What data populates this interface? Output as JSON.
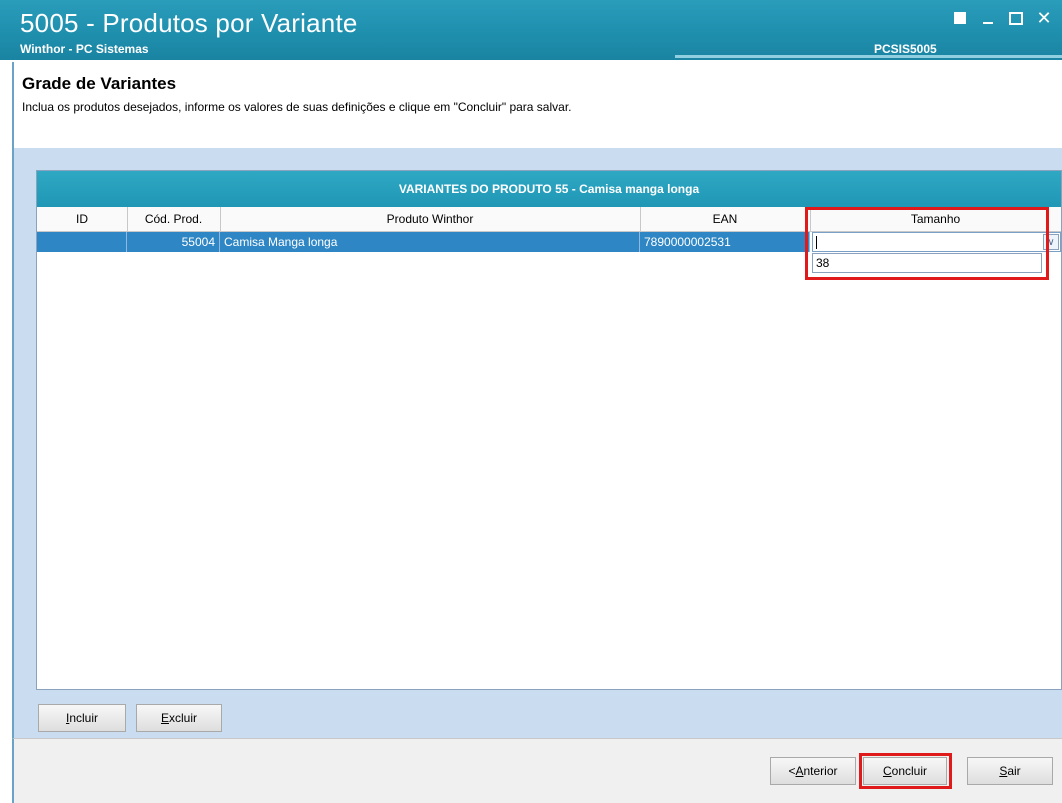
{
  "window": {
    "title": "5005 - Produtos por Variante",
    "subtitle": "Winthor - PC Sistemas",
    "module_code": "PCSIS5005",
    "controls": {
      "restore": "restore",
      "minimize": "minimize",
      "maximize": "maximize",
      "close": "✕"
    }
  },
  "header": {
    "title": "Grade de Variantes",
    "description": "Inclua os produtos desejados, informe os valores de suas definições e clique em \"Concluir\" para salvar."
  },
  "grid": {
    "caption": "VARIANTES DO PRODUTO 55 - Camisa manga longa",
    "columns": [
      "ID",
      "Cód. Prod.",
      "Produto Winthor",
      "EAN",
      "Tamanho"
    ],
    "rows": [
      {
        "id": "",
        "cod_prod": "55004",
        "produto": "Camisa Manga longa",
        "ean": "7890000002531",
        "tamanho": ""
      }
    ],
    "tamanho_editor": {
      "value": "",
      "dropdown_options": [
        "38"
      ]
    }
  },
  "actions": {
    "incluir_prefix": "I",
    "incluir_rest": "ncluir",
    "excluir_prefix": "E",
    "excluir_rest": "xcluir"
  },
  "footer": {
    "anterior_before": "< ",
    "anterior_key": "A",
    "anterior_rest": "nterior",
    "concluir_key": "C",
    "concluir_rest": "oncluir",
    "sair_key": "S",
    "sair_rest": "air"
  },
  "colors": {
    "accent": "#1f97b5",
    "selection": "#2f86c4",
    "highlight": "#e01a1a",
    "panel": "#c9dcf0"
  }
}
